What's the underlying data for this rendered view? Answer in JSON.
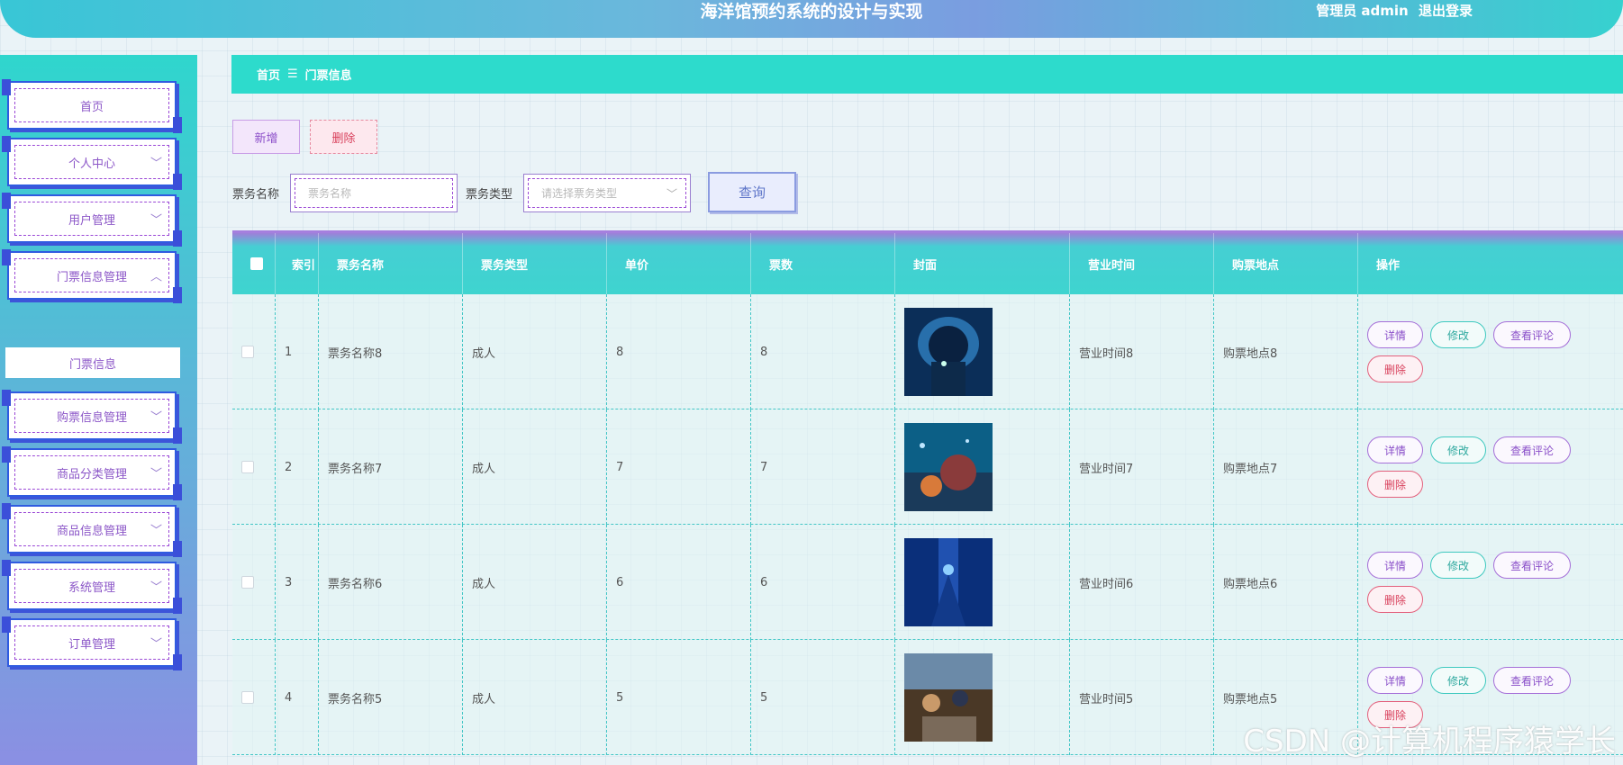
{
  "header": {
    "title": "海洋馆预约系统的设计与实现",
    "user_label": "管理员 admin",
    "logout_label": "退出登录"
  },
  "sidebar": {
    "items": [
      {
        "label": "首页",
        "has_chevron": false
      },
      {
        "label": "个人中心",
        "has_chevron": true
      },
      {
        "label": "用户管理",
        "has_chevron": true
      },
      {
        "label": "门票信息管理",
        "has_chevron": true,
        "expanded": true
      },
      {
        "label": "购票信息管理",
        "has_chevron": true
      },
      {
        "label": "商品分类管理",
        "has_chevron": true
      },
      {
        "label": "商品信息管理",
        "has_chevron": true
      },
      {
        "label": "系统管理",
        "has_chevron": true
      },
      {
        "label": "订单管理",
        "has_chevron": true
      }
    ],
    "active_sub": "门票信息"
  },
  "breadcrumb": {
    "home": "首页",
    "separator": "☰",
    "current": "门票信息"
  },
  "toolbar": {
    "add_label": "新增",
    "delete_label": "删除"
  },
  "search": {
    "name_label": "票务名称",
    "name_placeholder": "票务名称",
    "type_label": "票务类型",
    "type_placeholder": "请选择票务类型",
    "query_label": "查询"
  },
  "table": {
    "headers": [
      "索引",
      "票务名称",
      "票务类型",
      "单价",
      "票数",
      "封面",
      "营业时间",
      "购票地点",
      "操作"
    ],
    "rows": [
      {
        "index": "1",
        "name": "票务名称8",
        "type": "成人",
        "price": "8",
        "count": "8",
        "hours": "营业时间8",
        "place": "购票地点8"
      },
      {
        "index": "2",
        "name": "票务名称7",
        "type": "成人",
        "price": "7",
        "count": "7",
        "hours": "营业时间7",
        "place": "购票地点7"
      },
      {
        "index": "3",
        "name": "票务名称6",
        "type": "成人",
        "price": "6",
        "count": "6",
        "hours": "营业时间6",
        "place": "购票地点6"
      },
      {
        "index": "4",
        "name": "票务名称5",
        "type": "成人",
        "price": "5",
        "count": "5",
        "hours": "营业时间5",
        "place": "购票地点5"
      }
    ],
    "actions": {
      "detail": "详情",
      "edit": "修改",
      "comment": "查看评论",
      "delete": "删除"
    }
  },
  "watermark": "CSDN @计算机程序猿学长",
  "colors": {
    "accent_teal": "#2ddbcc",
    "accent_purple": "#8c57c8",
    "danger": "#d9425d"
  }
}
